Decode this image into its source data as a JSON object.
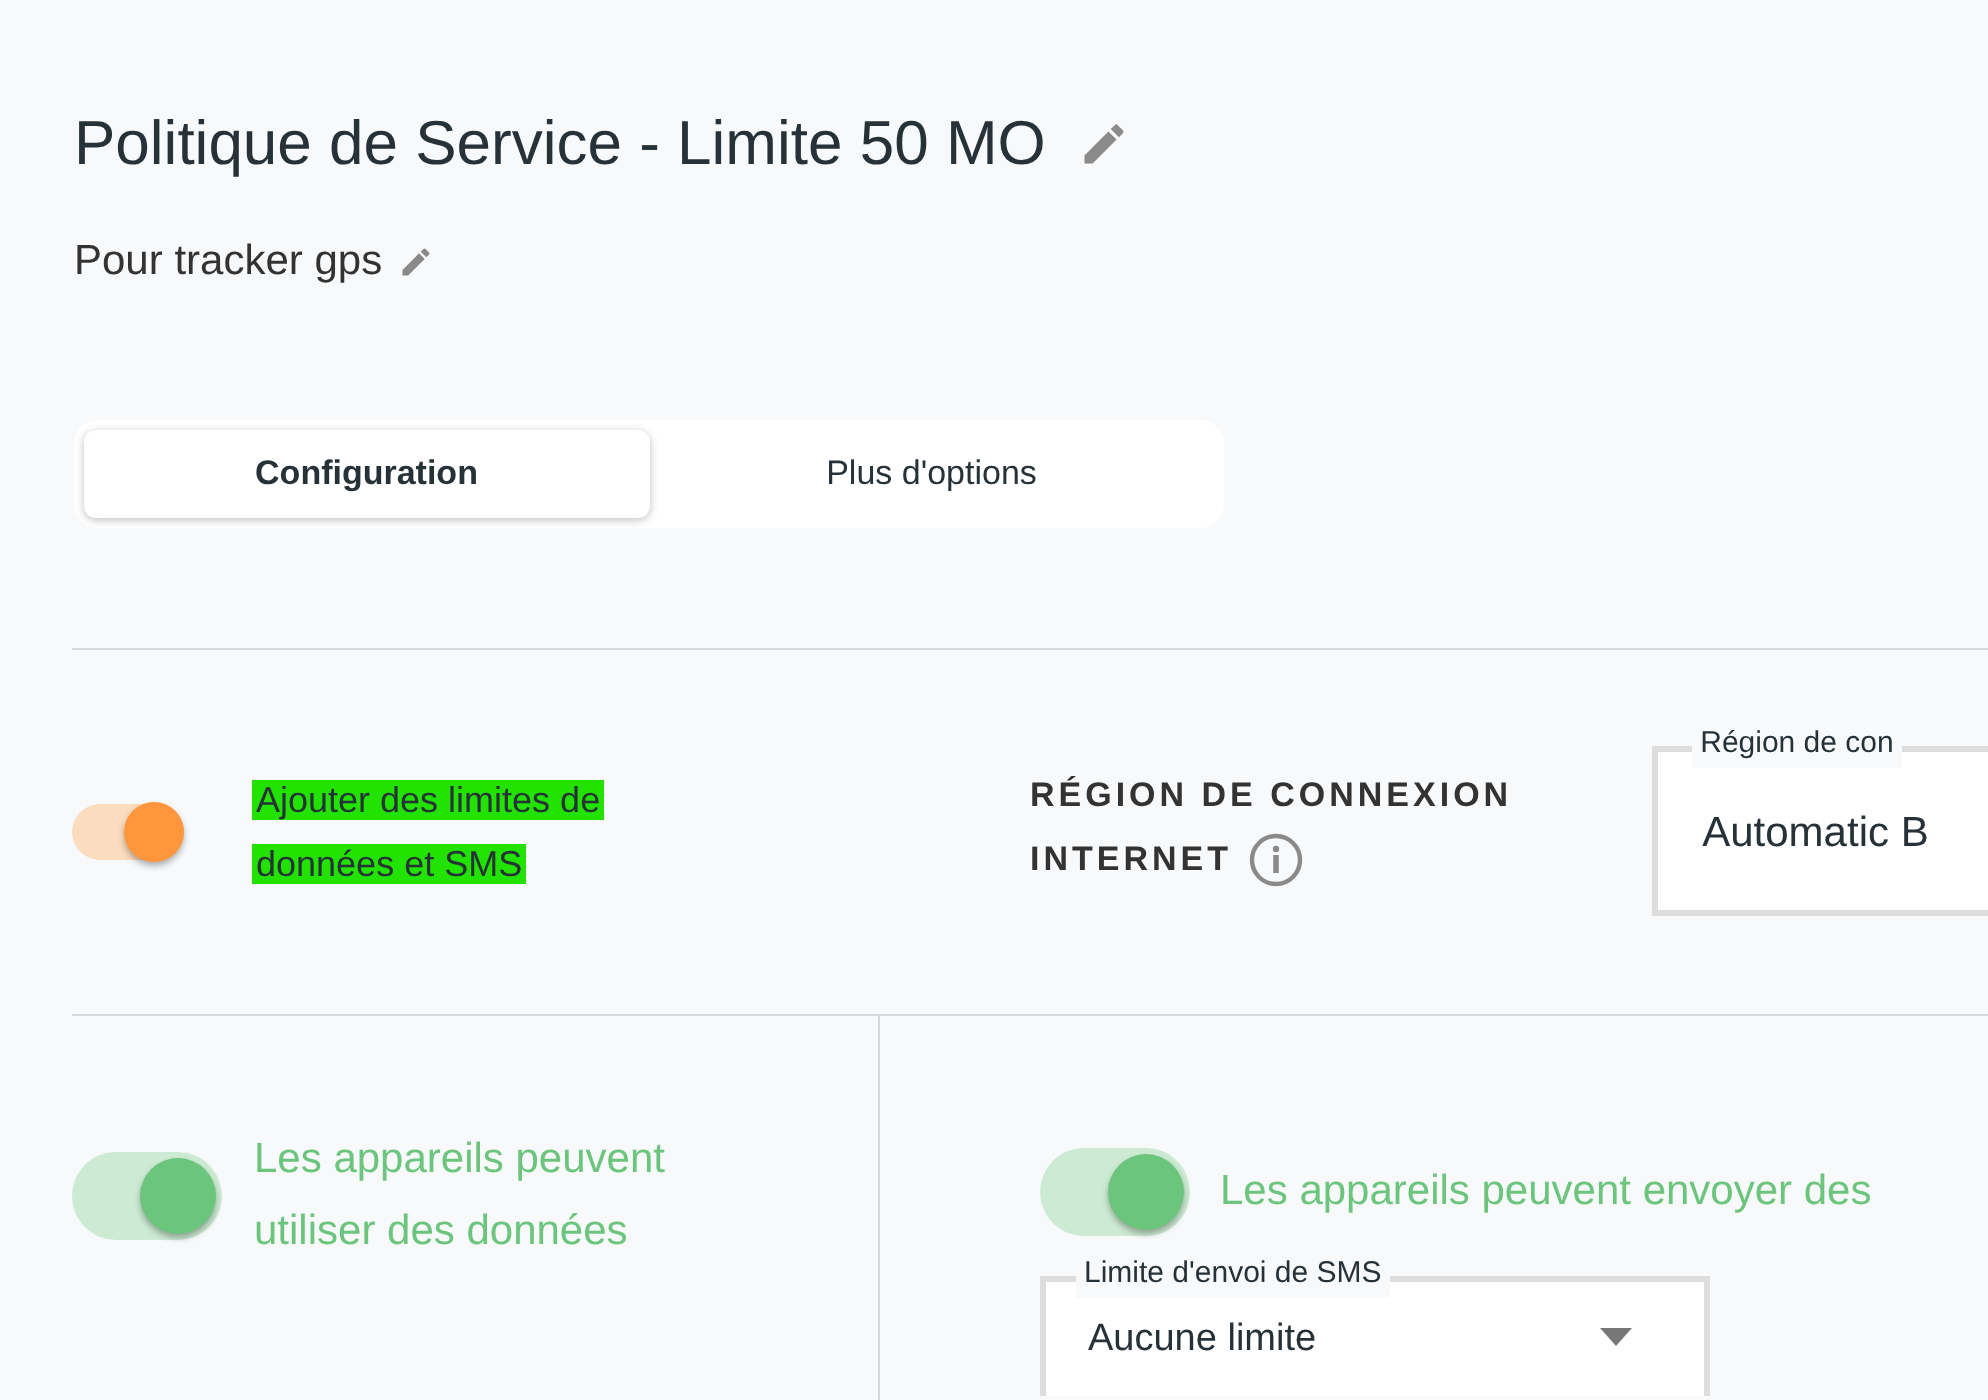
{
  "header": {
    "title": "Politique de Service - Limite 50 MO",
    "subtitle": "Pour tracker gps"
  },
  "tabs": [
    {
      "label": "Configuration",
      "selected": true
    },
    {
      "label": "Plus d'options",
      "selected": false
    }
  ],
  "limits": {
    "on": true,
    "label": "Ajouter des limites de données et SMS",
    "highlighted": true
  },
  "region": {
    "heading_lines": [
      "RÉGION DE CONNEXION",
      "INTERNET"
    ],
    "field_label": "Région de con",
    "value": "Automatic B"
  },
  "data": {
    "on": true,
    "label": "Les appareils peuvent utiliser des données"
  },
  "sms": {
    "on": true,
    "label": "Les appareils peuvent envoyer des",
    "field_label": "Limite d'envoi de SMS",
    "value": "Aucune limite"
  }
}
